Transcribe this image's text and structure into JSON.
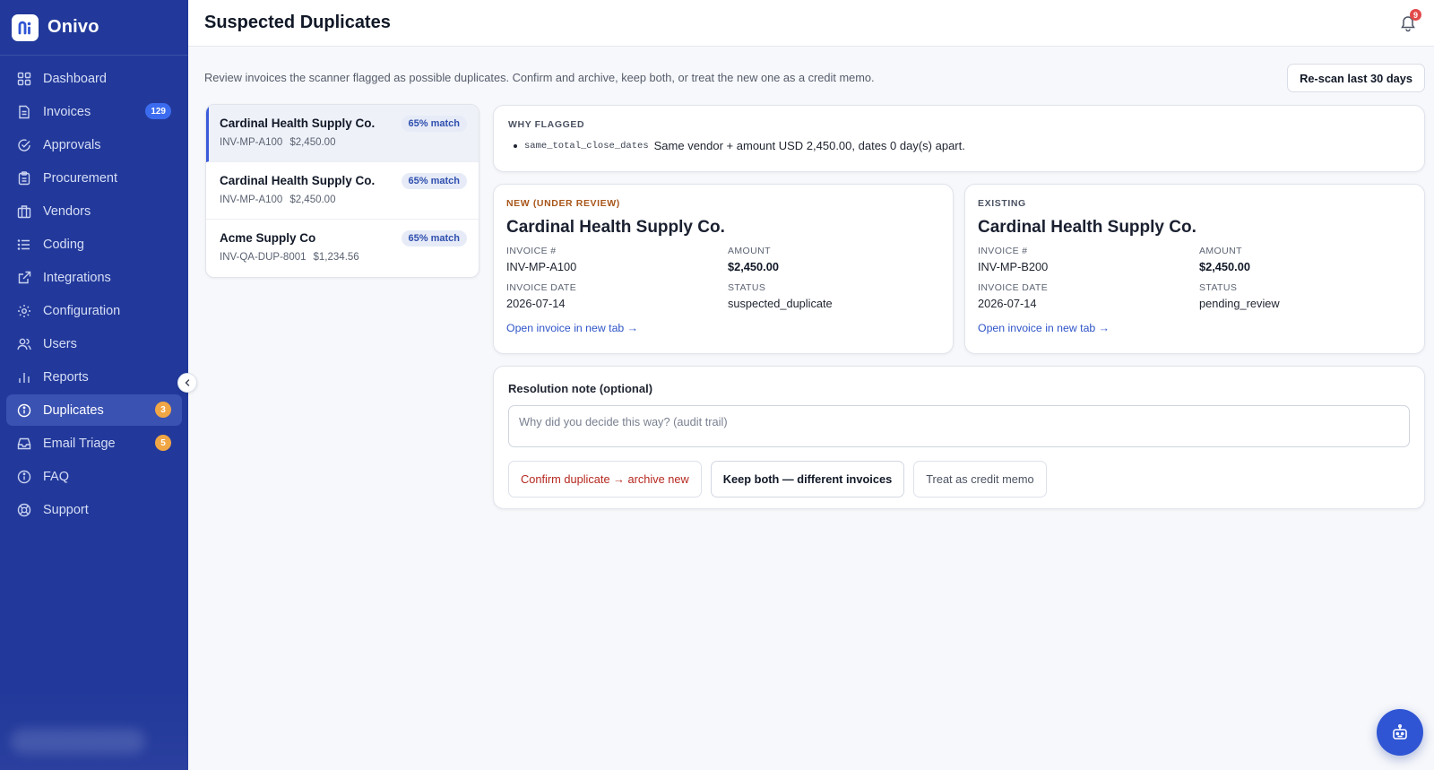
{
  "app": {
    "name": "Onivo"
  },
  "header": {
    "title": "Suspected Duplicates",
    "notifications": "9"
  },
  "sidebar": {
    "items": [
      {
        "label": "Dashboard",
        "icon": "dashboard-icon"
      },
      {
        "label": "Invoices",
        "icon": "invoice-icon",
        "badge": "129"
      },
      {
        "label": "Approvals",
        "icon": "check-circle-icon"
      },
      {
        "label": "Procurement",
        "icon": "clipboard-icon"
      },
      {
        "label": "Vendors",
        "icon": "building-icon"
      },
      {
        "label": "Coding",
        "icon": "list-icon"
      },
      {
        "label": "Integrations",
        "icon": "external-link-icon"
      },
      {
        "label": "Configuration",
        "icon": "gear-icon"
      },
      {
        "label": "Users",
        "icon": "users-icon"
      },
      {
        "label": "Reports",
        "icon": "bar-chart-icon"
      },
      {
        "label": "Duplicates",
        "icon": "info-icon",
        "badge": "3"
      },
      {
        "label": "Email Triage",
        "icon": "inbox-icon",
        "badge": "5"
      },
      {
        "label": "FAQ",
        "icon": "info-icon"
      },
      {
        "label": "Support",
        "icon": "lifebuoy-icon"
      }
    ]
  },
  "intro": "Review invoices the scanner flagged as possible duplicates. Confirm and archive, keep both, or treat the new one as a credit memo.",
  "rescan_label": "Re-scan last 30 days",
  "candidates": [
    {
      "vendor": "Cardinal Health Supply Co.",
      "invoice": "INV-MP-A100",
      "amount": "$2,450.00",
      "match": "65% match"
    },
    {
      "vendor": "Cardinal Health Supply Co.",
      "invoice": "INV-MP-A100",
      "amount": "$2,450.00",
      "match": "65% match"
    },
    {
      "vendor": "Acme Supply Co",
      "invoice": "INV-QA-DUP-8001",
      "amount": "$1,234.56",
      "match": "65% match"
    }
  ],
  "why": {
    "title": "WHY FLAGGED",
    "code": "same_total_close_dates",
    "text": "Same vendor + amount USD 2,450.00, dates 0 day(s) apart."
  },
  "new_invoice": {
    "kicker": "NEW (UNDER REVIEW)",
    "vendor": "Cardinal Health Supply Co.",
    "invoice_label": "INVOICE #",
    "invoice": "INV-MP-A100",
    "amount_label": "AMOUNT",
    "amount": "$2,450.00",
    "date_label": "INVOICE DATE",
    "date": "2026-07-14",
    "status_label": "STATUS",
    "status": "suspected_duplicate",
    "link": "Open invoice in new tab →"
  },
  "existing_invoice": {
    "kicker": "EXISTING",
    "vendor": "Cardinal Health Supply Co.",
    "invoice_label": "INVOICE #",
    "invoice": "INV-MP-B200",
    "amount_label": "AMOUNT",
    "amount": "$2,450.00",
    "date_label": "INVOICE DATE",
    "date": "2026-07-14",
    "status_label": "STATUS",
    "status": "pending_review",
    "link": "Open invoice in new tab →"
  },
  "resolution": {
    "label": "Resolution note (optional)",
    "placeholder": "Why did you decide this way? (audit trail)",
    "confirm": "Confirm duplicate → archive new",
    "keep": "Keep both — different invoices",
    "credit": "Treat as credit memo"
  },
  "colors": {
    "sidebar": "#22399b",
    "accent": "#2f55c8",
    "danger": "#b5281f",
    "badge_orange": "#f0a645"
  }
}
